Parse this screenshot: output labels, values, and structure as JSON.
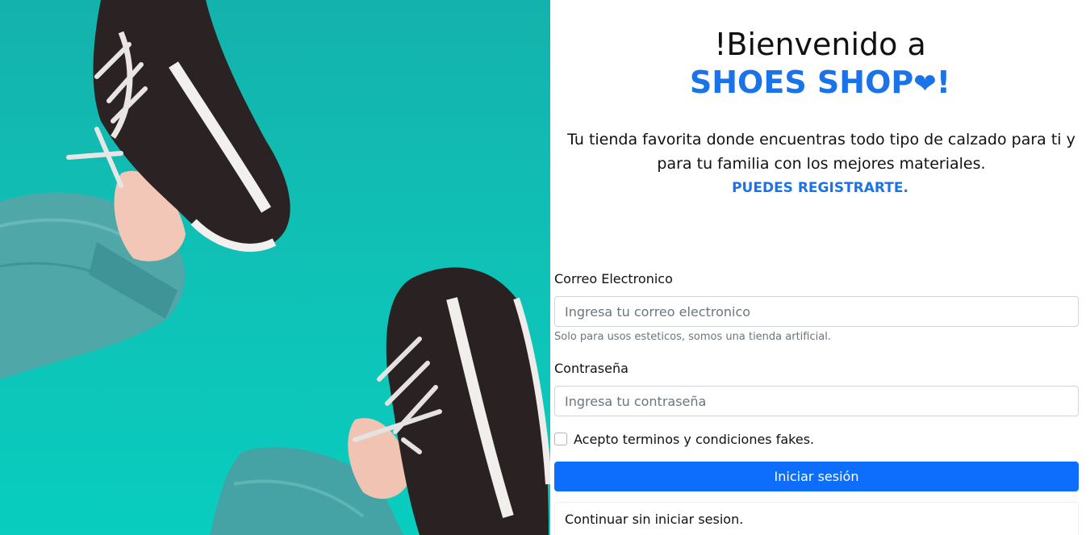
{
  "hero": {
    "image_description_icon": "shoes-photo"
  },
  "welcome": {
    "line1": "!Bienvenido a",
    "brand_name": "SHOES SHOP",
    "heart_symbol": "❤",
    "exclaim": "!"
  },
  "intro": {
    "tagline": "Tu tienda favorita donde encuentras todo tipo de calzado para ti y para tu familia con los mejores materiales.",
    "register_link": "PUEDES REGISTRARTE."
  },
  "form": {
    "email_label": "Correo Electronico",
    "email_placeholder": "Ingresa tu correo electronico",
    "email_value": "",
    "email_help": "Solo para usos esteticos, somos una tienda artificial.",
    "password_label": "Contraseña",
    "password_placeholder": "Ingresa tu contraseña",
    "password_value": "",
    "terms_label": "Acepto terminos y condiciones fakes.",
    "terms_checked": false,
    "submit_label": "Iniciar sesión",
    "continue_label": "Continuar sin iniciar sesion."
  },
  "colors": {
    "brand_blue": "#1a73e8",
    "button_blue": "#0d6efd",
    "hero_teal": "#10c0b5"
  }
}
